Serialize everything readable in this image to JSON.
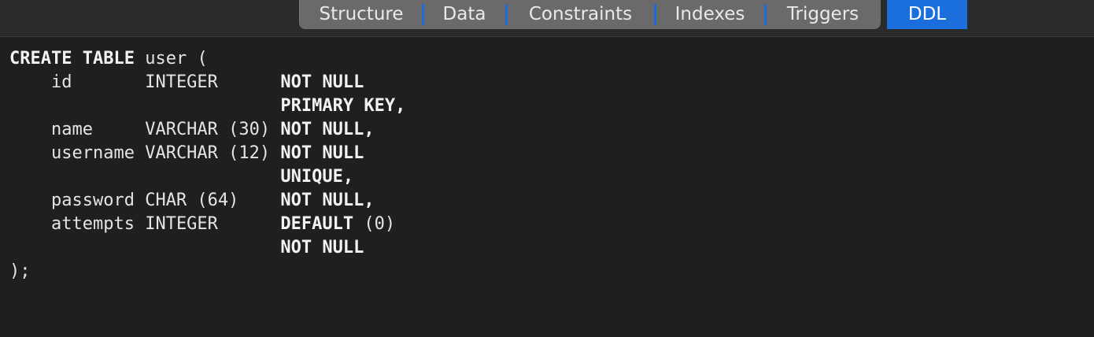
{
  "tabs": [
    {
      "label": "Structure"
    },
    {
      "label": "Data"
    },
    {
      "label": "Constraints"
    },
    {
      "label": "Indexes"
    },
    {
      "label": "Triggers"
    },
    {
      "label": "DDL",
      "active": true
    }
  ],
  "colors": {
    "tab_bg": "#6a6a6a",
    "active_tab_bg": "#1a6fdc",
    "editor_bg": "#1f1f1f"
  },
  "ddl": {
    "create_keyword": "CREATE TABLE",
    "table_name": "user",
    "open_paren": "(",
    "close": ");",
    "columns": [
      {
        "name": "id",
        "type": "INTEGER",
        "constraints": [
          "NOT NULL",
          "PRIMARY KEY,"
        ]
      },
      {
        "name": "name",
        "type": "VARCHAR (30)",
        "constraints": [
          "NOT NULL,"
        ]
      },
      {
        "name": "username",
        "type": "VARCHAR (12)",
        "constraints": [
          "NOT NULL",
          "UNIQUE,"
        ]
      },
      {
        "name": "password",
        "type": "CHAR (64)",
        "constraints": [
          "NOT NULL,"
        ]
      },
      {
        "name": "attempts",
        "type": "INTEGER",
        "constraints": [
          "DEFAULT (0)",
          "NOT NULL"
        ]
      }
    ]
  }
}
